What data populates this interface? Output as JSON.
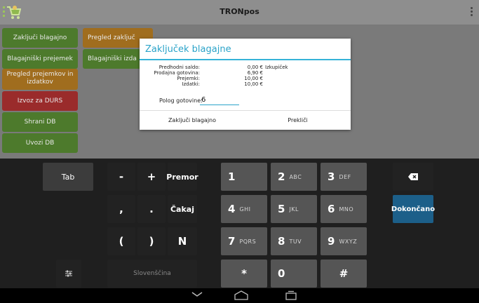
{
  "titlebar": {
    "title": "TRONpos",
    "logo": "cart-logo-icon",
    "menu": "overflow-menu-icon"
  },
  "left_menu": [
    {
      "label": "Zaključi blagajno",
      "color": "#4d7a2c"
    },
    {
      "label": "Pregled zaključ",
      "color": "#a06d1e"
    },
    {
      "label": "Blagajniški prejemek",
      "color": "#4d7a2c"
    },
    {
      "label": "Blagajniški izda",
      "color": "#4d7a2c"
    },
    {
      "label": "Pregled prejemkov in izdatkov",
      "color": "#a06d1e"
    },
    {
      "label": "Izvoz za DURS",
      "color": "#9a2b2b"
    },
    {
      "label": "Shrani DB",
      "color": "#4d7a2c"
    },
    {
      "label": "Uvozi DB",
      "color": "#4d7a2c"
    }
  ],
  "dialog": {
    "title": "Zaključek blagajne",
    "rows": [
      {
        "label": "Predhodni saldo:",
        "value": "0,00 €"
      },
      {
        "label": "Prodajna gotovina:",
        "value": "6,90 €"
      },
      {
        "label": "Prejemki:",
        "value": "10,00 €"
      },
      {
        "label": "Izdatki:",
        "value": "10,00 €"
      }
    ],
    "side_note": "Izkupiček",
    "polog_label": "Polog gotovine:",
    "polog_value": "6",
    "confirm_label": "Zaključi blagajno",
    "cancel_label": "Prekliči",
    "accent": "#2aa3c9"
  },
  "keyboard": {
    "tab": "Tab",
    "minus": "-",
    "plus": "+",
    "premor": "Premor",
    "comma": ",",
    "period": ".",
    "cakaj": "Čakaj",
    "paren_open": "(",
    "paren_close": ")",
    "n": "N",
    "language": "Slovenščina",
    "digits": [
      {
        "num": "1",
        "sub": ""
      },
      {
        "num": "2",
        "sub": "ABC"
      },
      {
        "num": "3",
        "sub": "DEF"
      },
      {
        "num": "4",
        "sub": "GHI"
      },
      {
        "num": "5",
        "sub": "JKL"
      },
      {
        "num": "6",
        "sub": "MNO"
      },
      {
        "num": "7",
        "sub": "PQRS"
      },
      {
        "num": "8",
        "sub": "TUV"
      },
      {
        "num": "9",
        "sub": "WXYZ"
      }
    ],
    "star": "*",
    "zero": "0",
    "hash": "#",
    "done": "Dokončano",
    "backspace_icon": "backspace-icon",
    "settings_icon": "keyboard-settings-icon",
    "done_color": "#1c5f89"
  },
  "navbar": {
    "back": "back-icon",
    "home": "home-icon",
    "recents": "recents-icon"
  }
}
